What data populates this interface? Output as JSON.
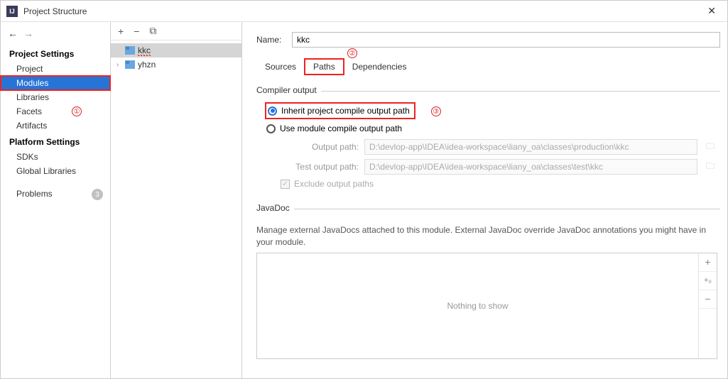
{
  "titlebar": {
    "title": "Project Structure"
  },
  "sidebar": {
    "section1": "Project Settings",
    "items1": [
      "Project",
      "Modules",
      "Libraries",
      "Facets",
      "Artifacts"
    ],
    "section2": "Platform Settings",
    "items2": [
      "SDKs",
      "Global Libraries"
    ],
    "problems": "Problems",
    "problems_count": "3"
  },
  "tree": {
    "items": [
      {
        "label": "kkc",
        "selected": true,
        "squiggly": true
      },
      {
        "label": "yhzn",
        "selected": false,
        "squiggly": false
      }
    ]
  },
  "content": {
    "name_label": "Name:",
    "name_value": "kkc",
    "tabs": [
      "Sources",
      "Paths",
      "Dependencies"
    ],
    "compiler_legend": "Compiler output",
    "radio_inherit": "Inherit project compile output path",
    "radio_module": "Use module compile output path",
    "output_label": "Output path:",
    "output_value": "D:\\devlop-app\\IDEA\\idea-workspace\\liany_oa\\classes\\production\\kkc",
    "test_output_label": "Test output path:",
    "test_output_value": "D:\\devlop-app\\IDEA\\idea-workspace\\liany_oa\\classes\\test\\kkc",
    "exclude_label": "Exclude output paths",
    "javadoc_legend": "JavaDoc",
    "javadoc_desc": "Manage external JavaDocs attached to this module. External JavaDoc override JavaDoc annotations you might have in your module.",
    "javadoc_empty": "Nothing to show"
  },
  "annotations": {
    "a1": "①",
    "a2": "②",
    "a3": "③"
  }
}
